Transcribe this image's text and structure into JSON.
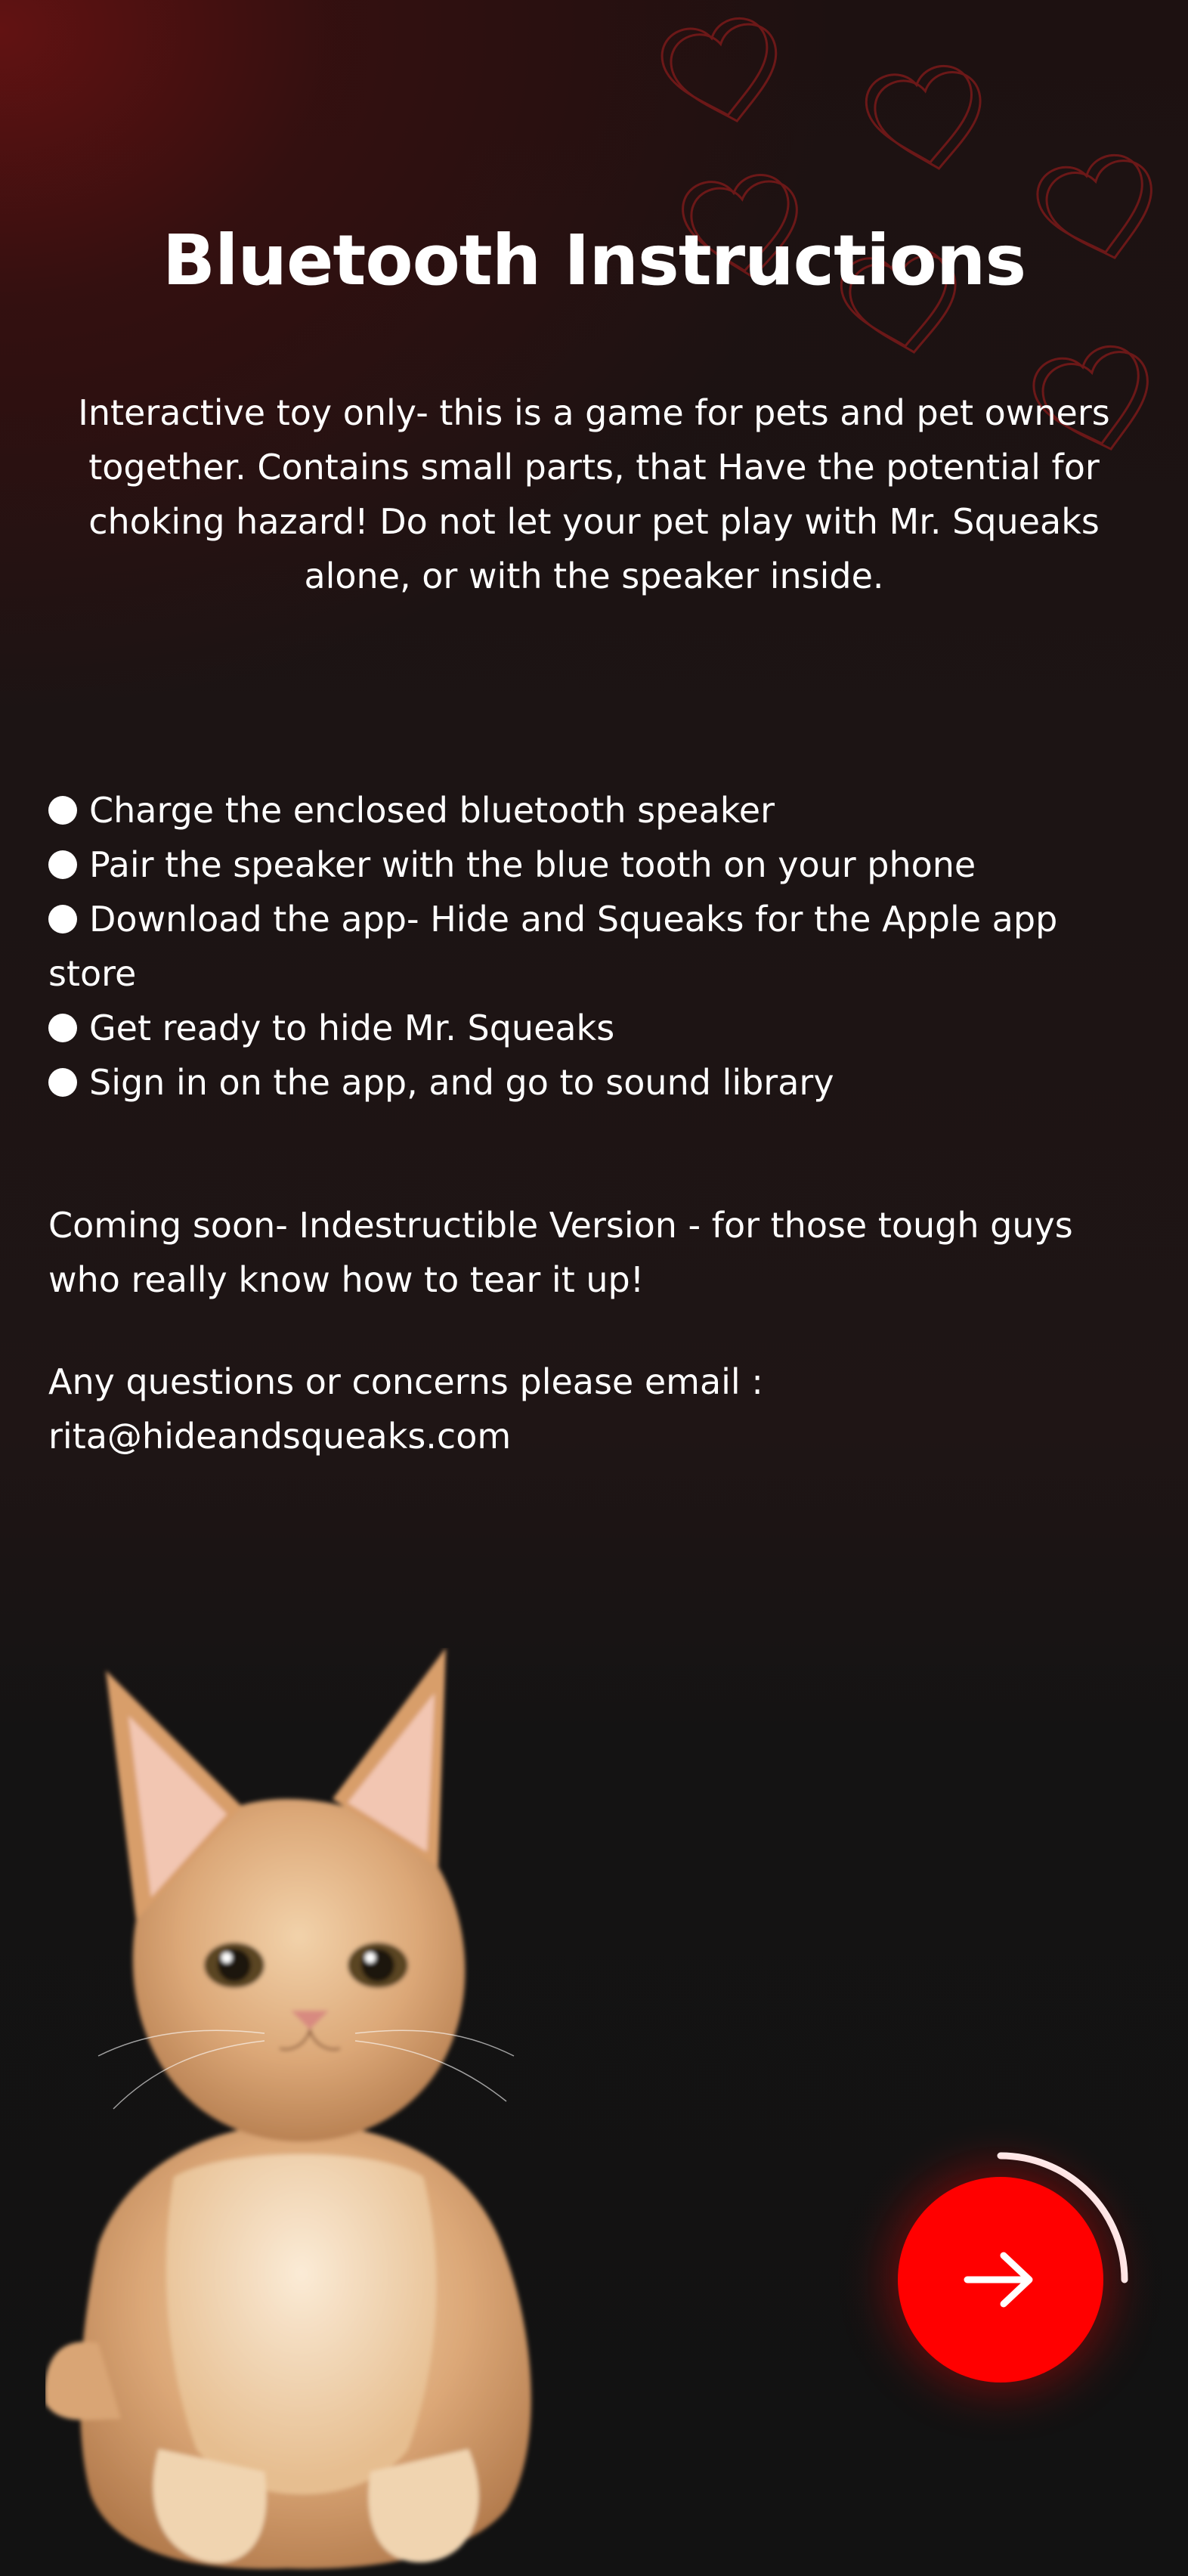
{
  "page": {
    "title": "Bluetooth Instructions",
    "intro": "Interactive toy only- this is a game for pets and pet owners together. Contains small parts, that Have the potential for choking hazard! Do not let your pet play with Mr. Squeaks alone, or with the speaker inside.",
    "steps": [
      "Charge the enclosed bluetooth speaker",
      "Pair the speaker with the blue tooth on your phone",
      "Download the app- Hide and Squeaks for the Apple app store",
      "Get ready to hide Mr. Squeaks",
      "Sign in on the app, and go to sound library"
    ],
    "coming_soon": "Coming soon- Indestructible Version - for those tough guys who really know how to tear it up!",
    "contact_line": "Any questions or concerns please email :",
    "contact_email": "rita@hideandsqueaks.com"
  },
  "icons": {
    "background": "heart-outline-icons",
    "next": "arrow-right-icon",
    "illustration": "kitten-image"
  },
  "next_button": {
    "progress_fraction": 0.25
  },
  "colors": {
    "accent": "#ff0000",
    "heart_outline": "#7a1a1a",
    "text": "#ffffff",
    "background": "#131313"
  }
}
